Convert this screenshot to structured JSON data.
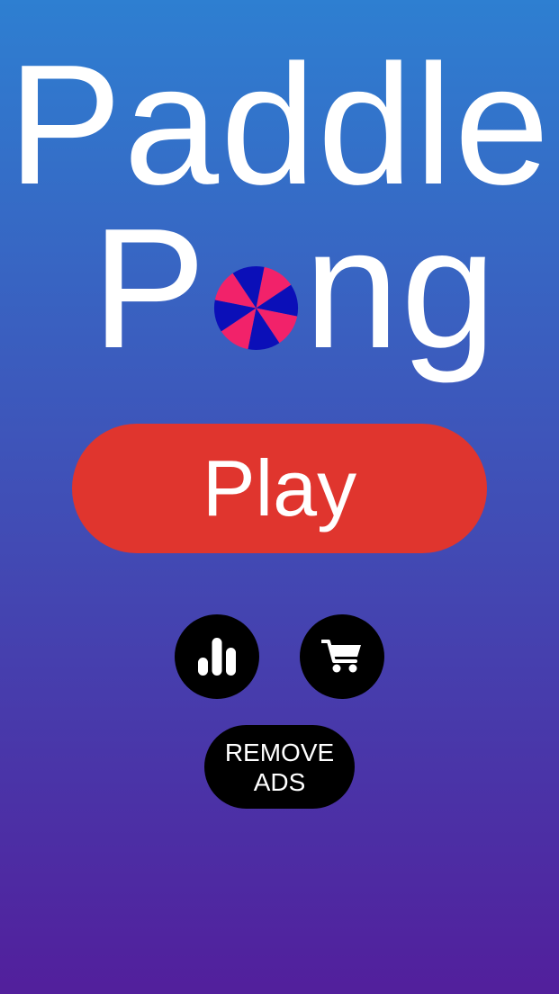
{
  "title": {
    "line1": "Paddle",
    "line2_before": "P",
    "line2_after": "ng"
  },
  "ball": {
    "icon": "beach-ball-icon",
    "color_a": "#f2226a",
    "color_b": "#0b0fb8"
  },
  "play_button": {
    "label": "Play",
    "color": "#e0352e"
  },
  "leaderboard_button": {
    "icon": "bar-chart-icon"
  },
  "shop_button": {
    "icon": "shopping-cart-icon"
  },
  "remove_ads_button": {
    "line1": "REMOVE",
    "line2": "ADS"
  },
  "background": {
    "top_color": "#2e7fd1",
    "bottom_color": "#521f9c"
  }
}
